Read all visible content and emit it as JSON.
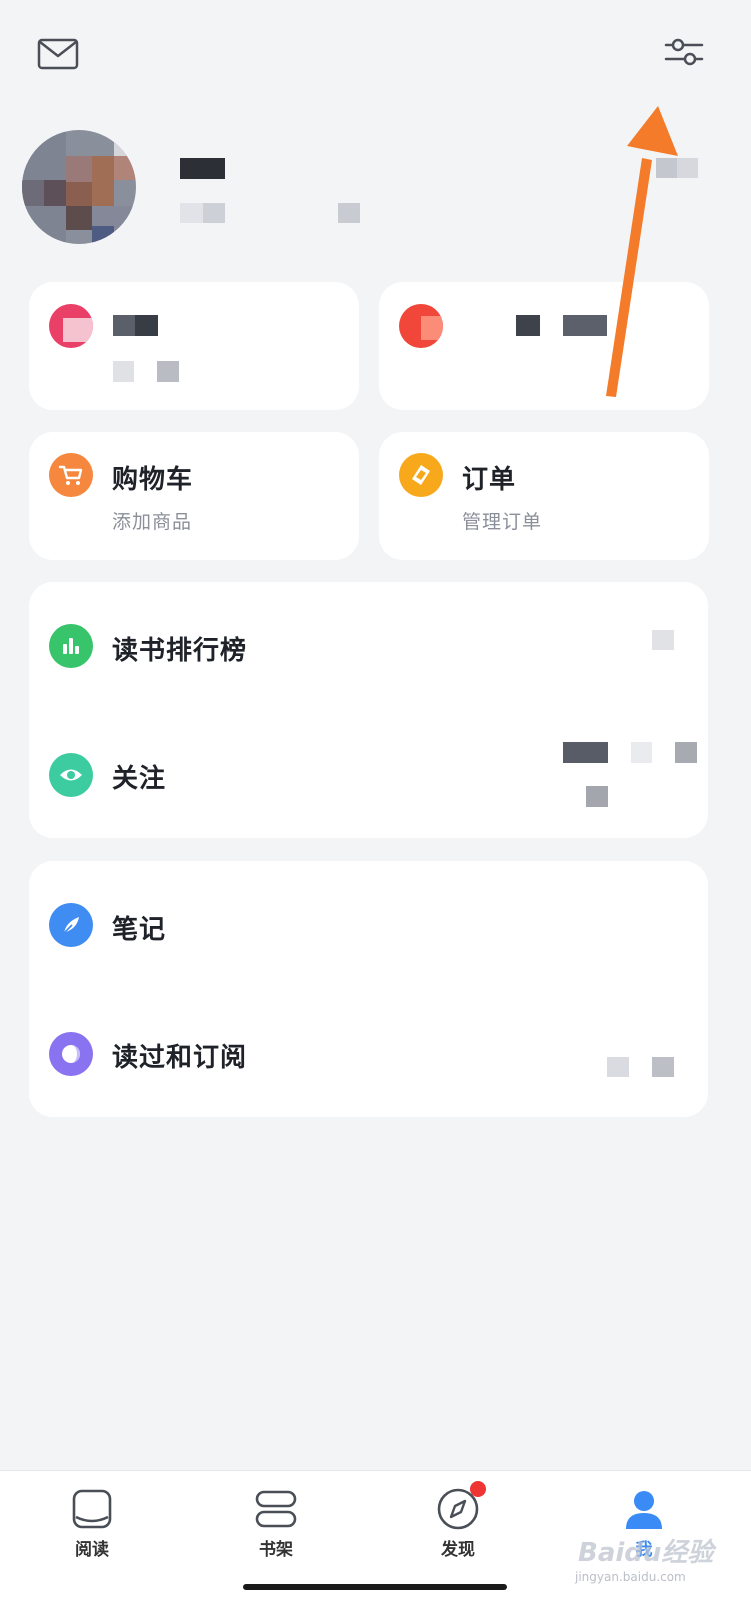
{
  "header": {
    "mail_icon": "envelope-icon",
    "settings_icon": "sliders-icon"
  },
  "annotation": {
    "color": "#f47b2a",
    "icon": "arrow-up-icon"
  },
  "shortcuts": {
    "cart": {
      "title": "购物车",
      "subtitle": "添加商品",
      "icon": "cart-icon",
      "color": "#f5873e"
    },
    "orders": {
      "title": "订单",
      "subtitle": "管理订单",
      "icon": "orders-icon",
      "color": "#f7a81b"
    }
  },
  "menu_group_1": [
    {
      "label": "读书排行榜",
      "icon": "bar-chart-icon",
      "color": "#37c46a"
    },
    {
      "label": "关注",
      "icon": "eye-icon",
      "color": "#3dcca0"
    }
  ],
  "menu_group_2": [
    {
      "label": "笔记",
      "icon": "feather-icon",
      "color": "#3f8cf2"
    },
    {
      "label": "读过和订阅",
      "icon": "moon-icon",
      "color": "#8a73f0"
    }
  ],
  "tabs": [
    {
      "label": "阅读",
      "icon": "book-icon"
    },
    {
      "label": "书架",
      "icon": "shelf-icon"
    },
    {
      "label": "发现",
      "icon": "compass-icon",
      "badge": true
    },
    {
      "label": "我",
      "icon": "person-icon",
      "active": true
    }
  ],
  "watermark": {
    "text": "Baidu经验",
    "sub": "jingyan.baidu.com"
  }
}
